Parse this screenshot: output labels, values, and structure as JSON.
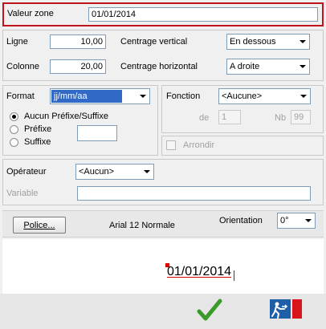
{
  "zone": {
    "label": "Valeur zone",
    "value": "01/01/2014"
  },
  "position": {
    "ligne_label": "Ligne",
    "ligne_value": "10,00",
    "colonne_label": "Colonne",
    "colonne_value": "20,00",
    "centrage_vertical_label": "Centrage vertical",
    "centrage_vertical_value": "En dessous",
    "centrage_horizontal_label": "Centrage horizontal",
    "centrage_horizontal_value": "A droite"
  },
  "format": {
    "label": "Format",
    "value": "jj/mm/aa",
    "options": [
      {
        "label": "Aucun Préfixe/Suffixe",
        "selected": true
      },
      {
        "label": "Préfixe",
        "selected": false
      },
      {
        "label": "Suffixe",
        "selected": false
      }
    ],
    "prefix_value": ""
  },
  "fonction": {
    "label": "Fonction",
    "value": "<Aucune>",
    "de_label": "de",
    "de_value": "1",
    "nb_label": "Nb",
    "nb_value": "99",
    "arrondir_label": "Arrondir"
  },
  "operateur": {
    "label": "Opérateur",
    "value": "<Aucun>",
    "variable_label": "Variable",
    "variable_value": ""
  },
  "font": {
    "police_button": "Police...",
    "description": "Arial 12 Normale",
    "orientation_label": "Orientation",
    "orientation_value": "0°"
  },
  "preview": {
    "text": "01/01/2014"
  },
  "icons": {
    "ok": "checkmark-icon",
    "exit": "exit-door-icon"
  },
  "colors": {
    "highlight": "#cc0000",
    "ok": "#3a9a2a",
    "exit_bg": "#1f5fa8"
  }
}
